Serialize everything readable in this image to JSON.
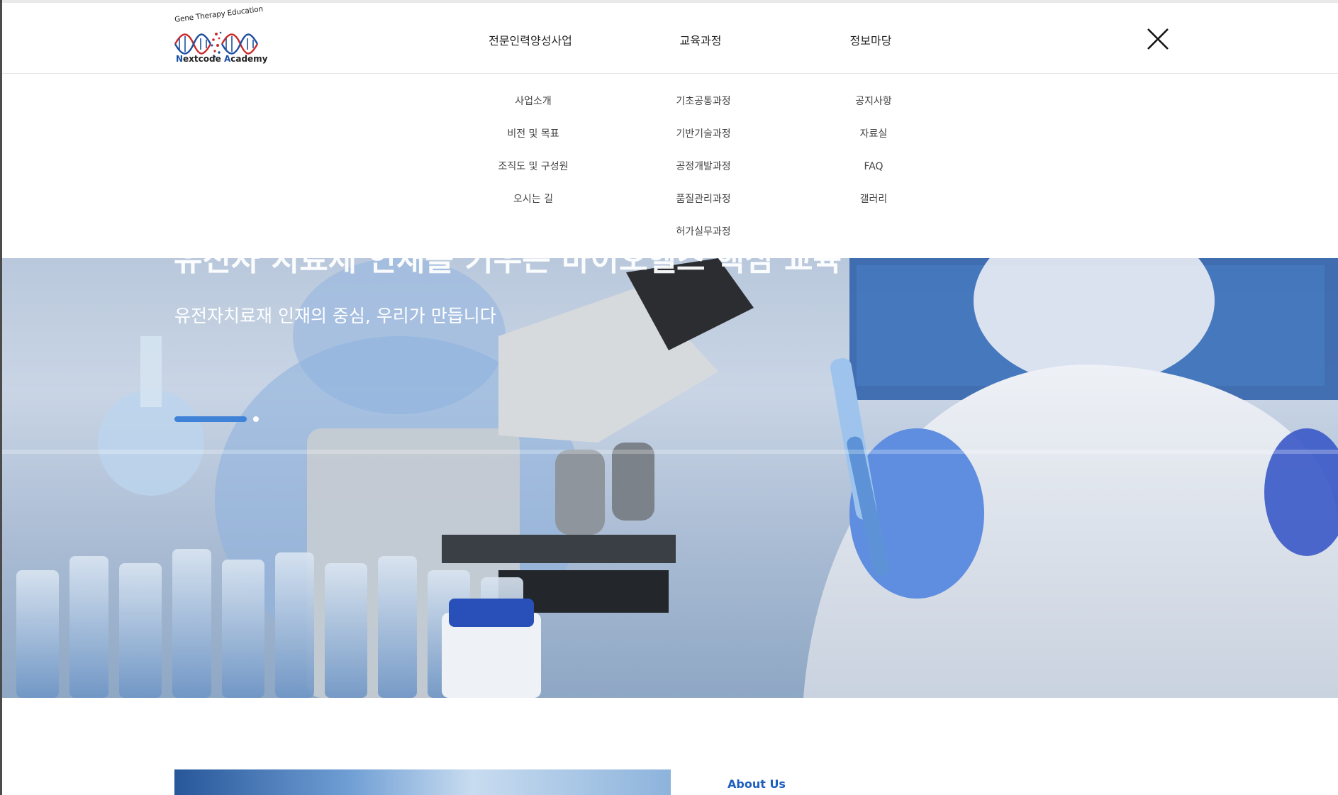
{
  "logo": {
    "top_text": "Gene Therapy Education",
    "bottom_text_parts": [
      "N",
      "extcode ",
      "A",
      "cademy"
    ]
  },
  "nav": [
    {
      "label": "전문인력양성사업",
      "items": [
        "사업소개",
        "비전 및 목표",
        "조직도 및 구성원",
        "오시는 길"
      ]
    },
    {
      "label": "교육과정",
      "items": [
        "기초공통과정",
        "기반기술과정",
        "공정개발과정",
        "품질관리과정",
        "허가실무과정"
      ]
    },
    {
      "label": "정보마당",
      "items": [
        "공지사항",
        "자료실",
        "FAQ",
        "갤러리"
      ]
    }
  ],
  "close_icon": "close-x-icon",
  "hero": {
    "title": "유전자 치료제 인재를 키우는 바이오헬스 핵심 교육",
    "subtitle": "유전자치료재 인재의 중심, 우리가 만듭니다",
    "slides_total": 2,
    "slide_active": 1
  },
  "about": {
    "label": "About Us"
  },
  "colors": {
    "accent": "#3f82d8",
    "about_label": "#1d5fbf"
  }
}
